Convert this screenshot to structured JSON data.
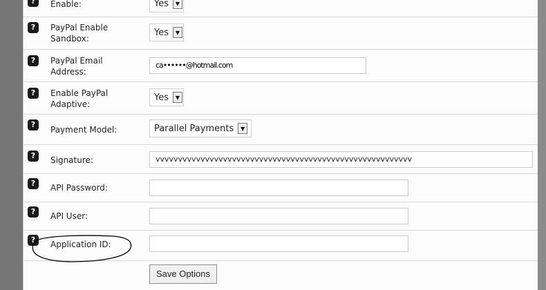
{
  "form": {
    "help_glyph": "?",
    "rows": [
      {
        "label": "Enable:",
        "control": "select",
        "value": "Yes"
      },
      {
        "label": "PayPal Enable Sandbox:",
        "control": "select",
        "value": "Yes"
      },
      {
        "label": "PayPal Email Address:",
        "control": "input",
        "value": "ca••••••@hotmail.com"
      },
      {
        "label": "Enable PayPal Adaptive:",
        "control": "select",
        "value": "Yes"
      },
      {
        "label": "Payment Model:",
        "control": "select",
        "value": "Parallel Payments"
      },
      {
        "label": "Signature:",
        "control": "input",
        "value": "vvvvvvvvvvvvvvvvvvvvvvvvvvvvvvvvvvvvvvvvvvvvvvvvvvvvvvvvv"
      },
      {
        "label": "API Password:",
        "control": "input",
        "value": ""
      },
      {
        "label": "API User:",
        "control": "input",
        "value": ""
      },
      {
        "label": "Application ID:",
        "control": "input",
        "value": ""
      }
    ],
    "save_label": "Save Options"
  },
  "colors": {
    "background": "#7a7a7a",
    "panel": "#fcfcfc",
    "help_icon": "#1a1a1a",
    "circle_annotation": "#000000"
  },
  "icons": {
    "help": "question-mark-icon",
    "dropdown": "chevron-down-icon"
  }
}
